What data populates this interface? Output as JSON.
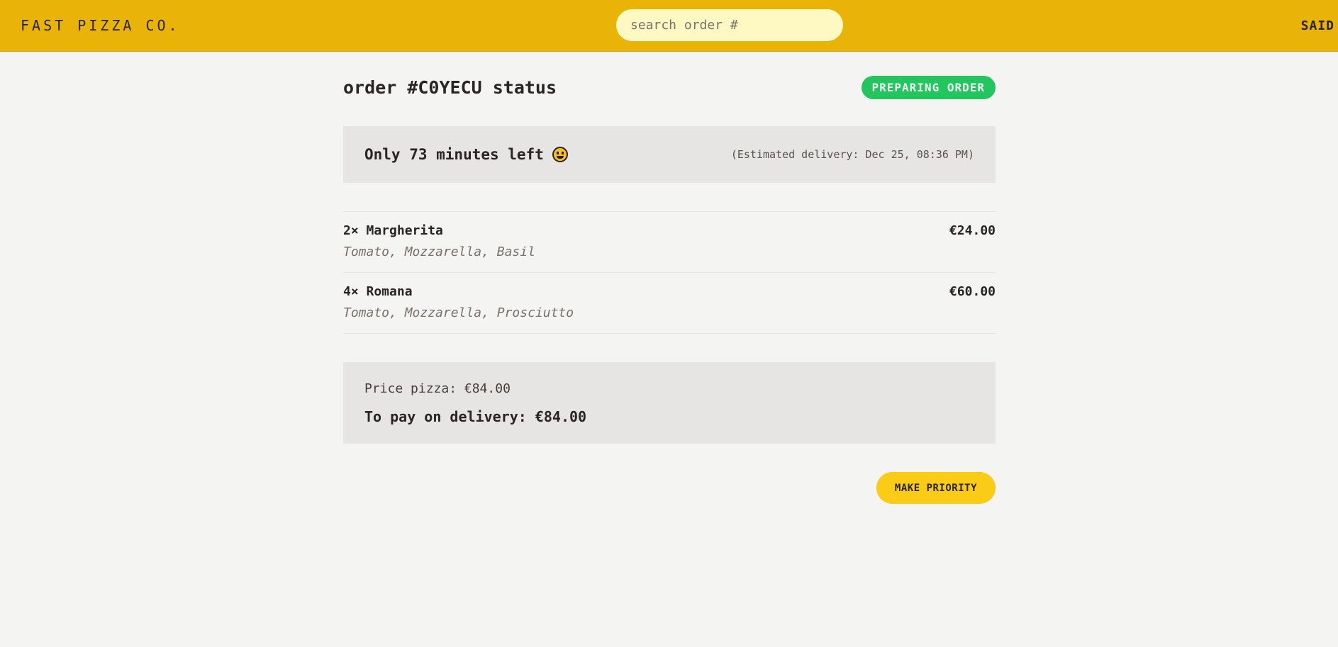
{
  "header": {
    "logo": "FAST PIZZA CO.",
    "search_placeholder": "search order #",
    "username": "SAID"
  },
  "order": {
    "title": "order #C0YECU status",
    "status": "PREPARING ORDER",
    "eta_text": "Only 73 minutes left",
    "eta_emoji": "grinning-face-icon",
    "estimated_delivery": "(Estimated delivery: Dec 25, 08:36 PM)",
    "items": [
      {
        "name": "2× Margherita",
        "price": "€24.00",
        "ingredients": "Tomato, Mozzarella, Basil"
      },
      {
        "name": "4× Romana",
        "price": "€60.00",
        "ingredients": "Tomato, Mozzarella, Prosciutto"
      }
    ],
    "price_pizza": "Price pizza: €84.00",
    "to_pay": "To pay on delivery: €84.00",
    "priority_button": "MAKE PRIORITY"
  },
  "colors": {
    "header_bg": "#eab308",
    "search_bg": "#fef9c3",
    "status_badge": "#22c55e",
    "button_bg": "#facc15",
    "page_bg": "#f4f4f2",
    "panel_bg": "#e7e5e3"
  }
}
